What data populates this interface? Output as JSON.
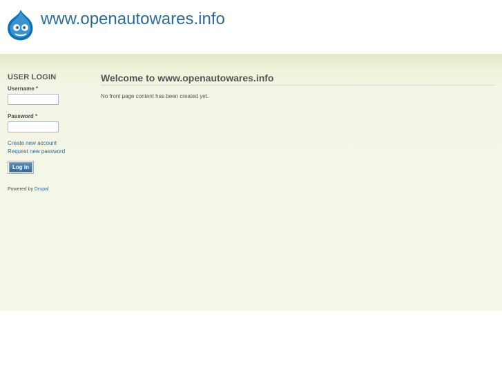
{
  "header": {
    "site_name": "www.openautowares.info",
    "logo_icon": "drupal-drop-icon"
  },
  "sidebar": {
    "block_title": "USER LOGIN",
    "username_label": "Username",
    "password_label": "Password",
    "required_marker": "*",
    "links": [
      "Create new account",
      "Request new password"
    ],
    "login_button": "Log in",
    "powered_by_text": "Powered by",
    "powered_by_link": "Drupal"
  },
  "main": {
    "title": "Welcome to www.openautowares.info",
    "text": "No front page content has been created yet."
  },
  "colors": {
    "link": "#2e6a97",
    "band": "#f4f6e8",
    "button": "#33679a"
  }
}
